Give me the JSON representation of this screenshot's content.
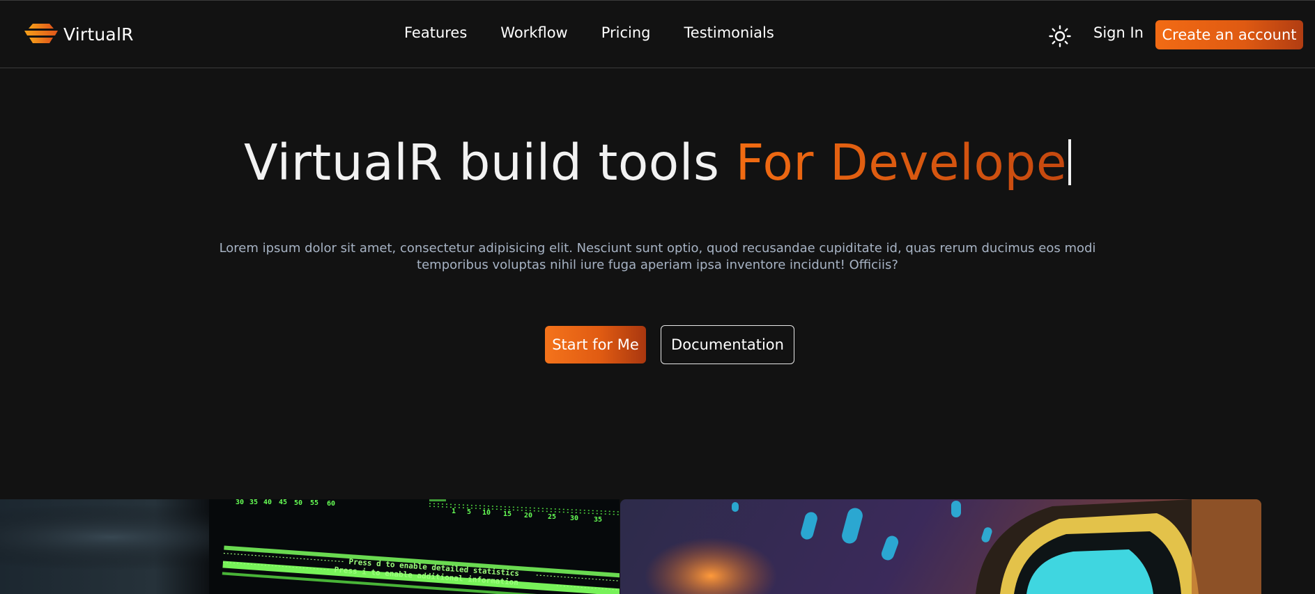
{
  "brand": {
    "name": "VirtualR"
  },
  "nav": {
    "items": [
      "Features",
      "Workflow",
      "Pricing",
      "Testimonials"
    ]
  },
  "header_actions": {
    "theme_icon": "sun-icon",
    "sign_in": "Sign In",
    "create_account": "Create an account"
  },
  "hero": {
    "title_main": "VirtualR build tools ",
    "title_accent": "For Develope",
    "description": "Lorem ipsum dolor sit amet, consectetur adipisicing elit. Nesciunt sunt optio, quod recusandae cupiditate id, quas rerum ducimus eos modi temporibus voluptas nihil iure fuga aperiam ipsa inventore incidunt! Officiis?",
    "primary_button": "Start for Me",
    "secondary_button": "Documentation"
  },
  "terminal": {
    "scale_top": [
      "30",
      "35",
      "40",
      "45",
      "50",
      "55",
      "60"
    ],
    "scale_right": [
      "1",
      "5",
      "10",
      "15",
      "20",
      "25",
      "30",
      "35"
    ],
    "lines": [
      "Press d to enable detailed statistics",
      "Press i to enable additional information"
    ]
  },
  "colors": {
    "background": "#121212",
    "accent": "#f26b14",
    "accent_dark": "#b13d12",
    "muted_text": "#a7b3c4"
  }
}
